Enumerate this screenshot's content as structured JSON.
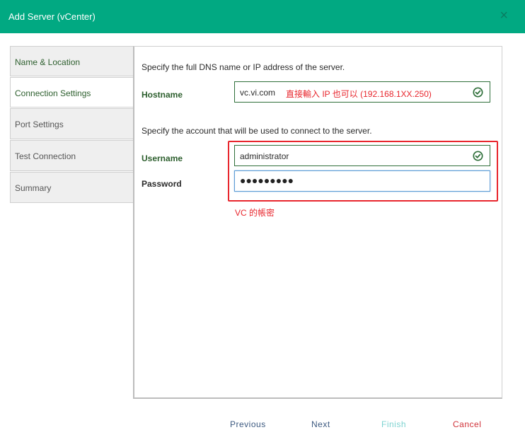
{
  "dialog": {
    "title": "Add Server (vCenter)",
    "close_glyph": "×"
  },
  "nav": {
    "items": [
      {
        "label": "Name & Location",
        "state": "done"
      },
      {
        "label": "Connection Settings",
        "state": "active"
      },
      {
        "label": "Port Settings",
        "state": "pending"
      },
      {
        "label": "Test Connection",
        "state": "pending"
      },
      {
        "label": "Summary",
        "state": "pending"
      }
    ]
  },
  "form": {
    "server_instructions": "Specify the full DNS name or IP address of the server.",
    "hostname_label": "Hostname",
    "hostname_value": "vc.vi.com",
    "hostname_annotation": "直接輸入 IP 也可以 (192.168.1XX.250)",
    "account_instructions": "Specify the account that will be used to connect to the server.",
    "username_label": "Username",
    "username_value": "administrator",
    "password_label": "Password",
    "password_mask": "●●●●●●●●●",
    "password_annotation": "VC 的帳密"
  },
  "buttons": {
    "previous": "Previous",
    "next": "Next",
    "finish": "Finish",
    "cancel": "Cancel"
  },
  "colors": {
    "header": "#01a982",
    "valid_green": "#2f6f3a",
    "annotation_red": "#e8262d"
  },
  "icons": {
    "valid": "check-circle-icon",
    "close": "close-icon"
  }
}
